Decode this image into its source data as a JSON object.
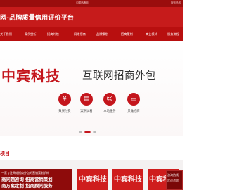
{
  "topbar": {
    "center_text": "中国品牌网",
    "right_text": "服务热线"
  },
  "header": {
    "title": "网-品牌质量信用评价平台"
  },
  "nav": {
    "items": [
      {
        "label": "关于我们"
      },
      {
        "label": "案例赏析"
      },
      {
        "label": "招商外包"
      },
      {
        "label": "网络招商"
      },
      {
        "label": "品牌策划"
      },
      {
        "label": "招商策划"
      },
      {
        "label": "商业模式"
      },
      {
        "label": "服务流程"
      }
    ]
  },
  "banner": {
    "brand": "中宾科技",
    "slogan": "互联网招商外包",
    "features": [
      {
        "icon": "money-icon",
        "glyph": "¥",
        "label": "效果付费"
      },
      {
        "icon": "case-icon",
        "glyph": "▤",
        "label": "案例试看"
      },
      {
        "icon": "service-icon",
        "glyph": "☺",
        "label": "本地服务"
      },
      {
        "icon": "monitor-icon",
        "glyph": "▭",
        "label": "只做招商"
      }
    ],
    "slides": {
      "count": 3,
      "active_index": 0
    }
  },
  "section": {
    "title": "项目"
  },
  "info": {
    "line1": "一家专注网络招商外包的营销策划机构",
    "line2": "商问题咨询  招商营销策划",
    "line3": "商方案定制  招商顾问服务"
  },
  "cards": [
    {
      "title": "中宾科技"
    },
    {
      "title": "中宾科技"
    },
    {
      "title": "中宾科技"
    }
  ],
  "popup": {
    "title": "咨询热线",
    "body": "欢迎咨询"
  },
  "colors": {
    "primary_red": "#c61b1b",
    "dark_red": "#8e0b0b",
    "brand_red": "#c4151c"
  }
}
